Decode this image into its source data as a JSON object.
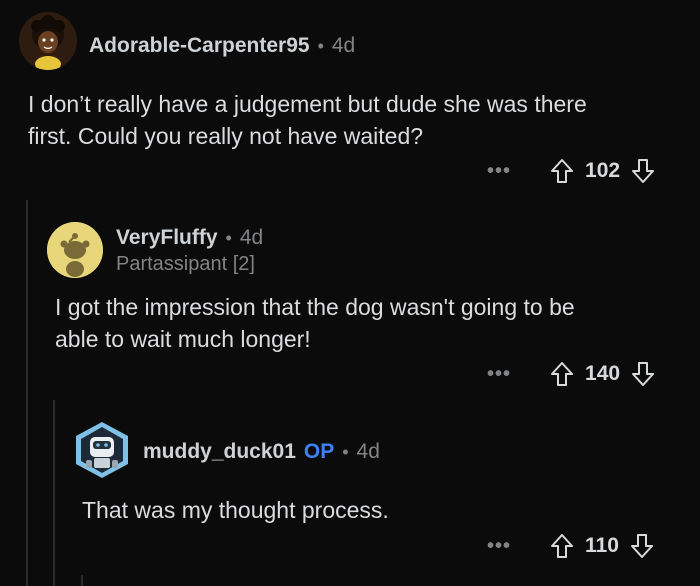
{
  "comments": [
    {
      "author": "Adorable-Carpenter95",
      "separator": "•",
      "time": "4d",
      "body_line1": "I don’t really have a judgement but dude she was there",
      "body_line2": "first. Could you really not have waited?",
      "more": "•••",
      "score": "102",
      "avatar_icon": "cartoon-avatar-icon"
    },
    {
      "author": "VeryFluffy",
      "separator": "•",
      "time": "4d",
      "flair": "Partassipant [2]",
      "body_line1": "I got the impression that the dog wasn't going to be",
      "body_line2": "able to wait much longer!",
      "more": "•••",
      "score": "140",
      "avatar_icon": "snoo-avatar-icon"
    },
    {
      "author": "muddy_duck01",
      "op_badge": "OP",
      "separator": "•",
      "time": "4d",
      "body_line1": "That was my thought process.",
      "more": "•••",
      "score": "110",
      "avatar_icon": "robot-avatar-icon"
    }
  ],
  "colors": {
    "background": "#0b0b0c",
    "text": "#d7dadc",
    "muted": "#818384",
    "op_badge": "#3a82f7",
    "thread_line": "#2a2b2d"
  }
}
